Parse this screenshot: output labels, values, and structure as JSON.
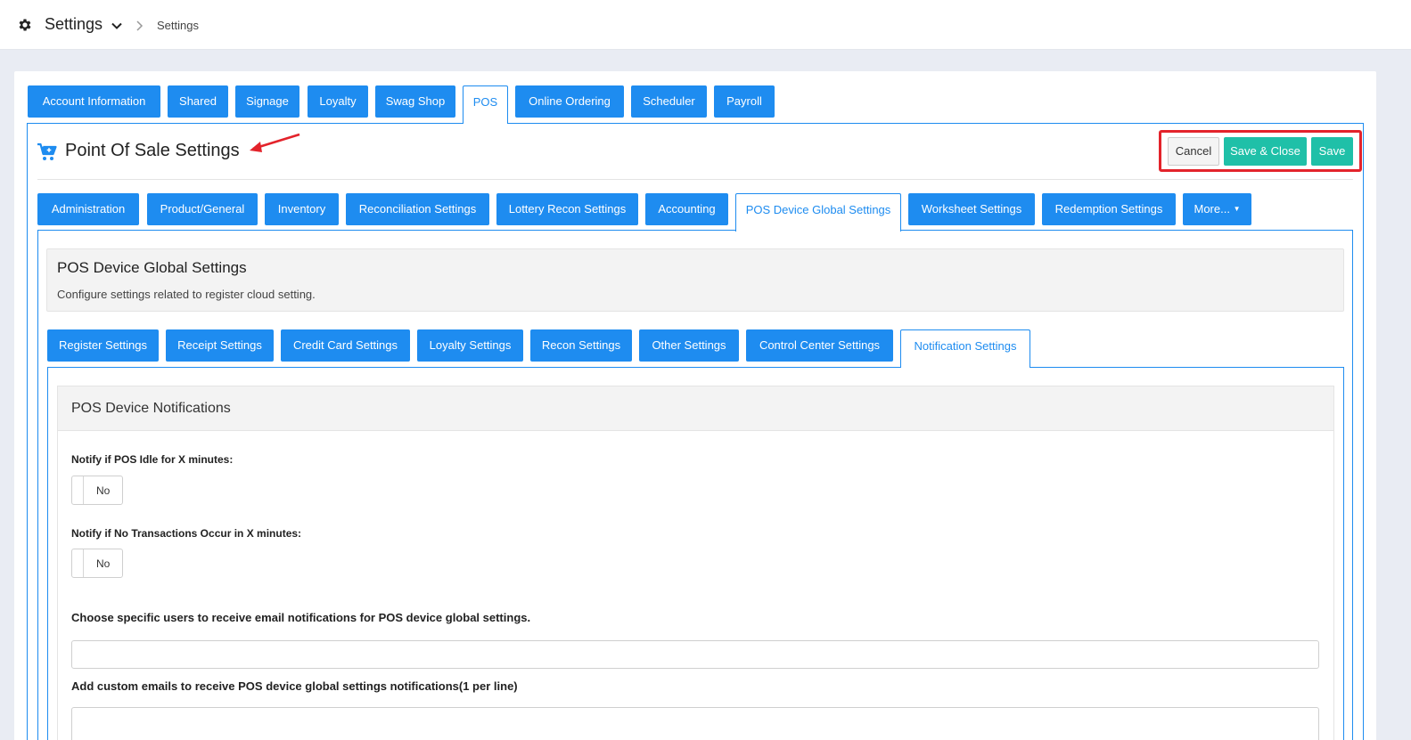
{
  "header": {
    "title": "Settings",
    "breadcrumb": "Settings"
  },
  "main_tabs": [
    {
      "label": "Account Information"
    },
    {
      "label": "Shared"
    },
    {
      "label": "Signage"
    },
    {
      "label": "Loyalty"
    },
    {
      "label": "Swag Shop"
    },
    {
      "label": "POS"
    },
    {
      "label": "Online Ordering"
    },
    {
      "label": "Scheduler"
    },
    {
      "label": "Payroll"
    }
  ],
  "section": {
    "title": "Point Of Sale Settings",
    "cancel_label": "Cancel",
    "save_close_label": "Save & Close",
    "save_label": "Save"
  },
  "sub_tabs": [
    {
      "label": "Administration"
    },
    {
      "label": "Product/General"
    },
    {
      "label": "Inventory"
    },
    {
      "label": "Reconciliation Settings"
    },
    {
      "label": "Lottery Recon Settings"
    },
    {
      "label": "Accounting"
    },
    {
      "label": "POS Device Global Settings"
    },
    {
      "label": "Worksheet Settings"
    },
    {
      "label": "Redemption Settings"
    },
    {
      "label": "More..."
    }
  ],
  "info": {
    "title": "POS Device Global Settings",
    "description": "Configure settings related to register cloud setting."
  },
  "device_tabs": [
    {
      "label": "Register Settings"
    },
    {
      "label": "Receipt Settings"
    },
    {
      "label": "Credit Card Settings"
    },
    {
      "label": "Loyalty Settings"
    },
    {
      "label": "Recon Settings"
    },
    {
      "label": "Other Settings"
    },
    {
      "label": "Control Center Settings"
    },
    {
      "label": "Notification Settings"
    }
  ],
  "notifications": {
    "title": "POS Device Notifications",
    "idle_label": "Notify if POS Idle for X minutes:",
    "idle_value": "No",
    "no_tx_label": "Notify if No Transactions Occur in X minutes:",
    "no_tx_value": "No",
    "users_label": "Choose specific users to receive email notifications for POS device global settings.",
    "emails_label": "Add custom emails to receive POS device global settings notifications(1 per line)"
  },
  "colors": {
    "accent": "#1e8cf0",
    "green": "#1fc0a8",
    "highlight": "#e3232b"
  }
}
